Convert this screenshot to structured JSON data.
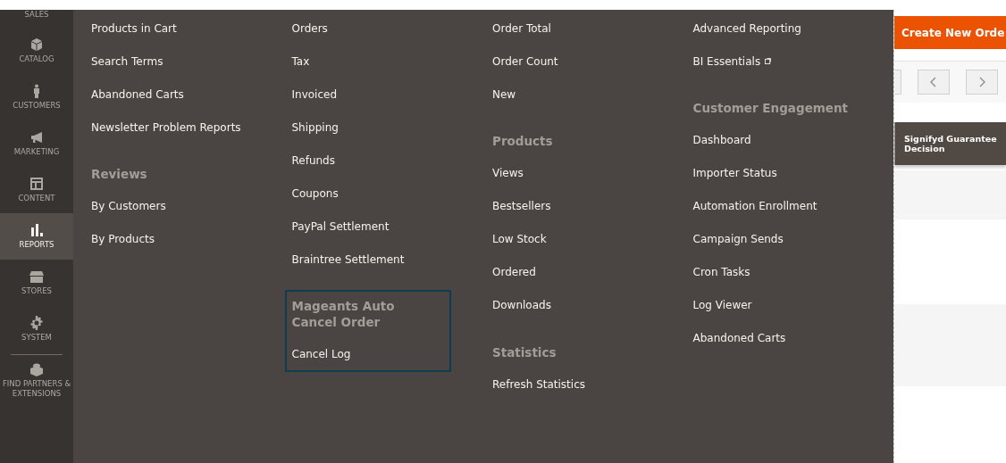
{
  "sidebar": {
    "items": [
      {
        "label": "SALES",
        "selected": false
      },
      {
        "label": "CATALOG",
        "selected": false
      },
      {
        "label": "CUSTOMERS",
        "selected": false
      },
      {
        "label": "MARKETING",
        "selected": false
      },
      {
        "label": "CONTENT",
        "selected": false
      },
      {
        "label": "REPORTS",
        "selected": true
      },
      {
        "label": "STORES",
        "selected": false
      },
      {
        "label": "SYSTEM",
        "selected": false
      },
      {
        "label": "FIND PARTNERS & EXTENSIONS",
        "selected": false,
        "divider_before": true
      }
    ]
  },
  "menu": {
    "columns": [
      {
        "groups": [
          {
            "items": [
              {
                "label": "Products in Cart"
              },
              {
                "label": "Search Terms"
              },
              {
                "label": "Abandoned Carts"
              },
              {
                "label": "Newsletter Problem Reports"
              }
            ]
          },
          {
            "title": "Reviews",
            "items": [
              {
                "label": "By Customers"
              },
              {
                "label": "By Products"
              }
            ]
          }
        ]
      },
      {
        "groups": [
          {
            "items": [
              {
                "label": "Orders"
              },
              {
                "label": "Tax"
              },
              {
                "label": "Invoiced"
              },
              {
                "label": "Shipping"
              },
              {
                "label": "Refunds"
              },
              {
                "label": "Coupons"
              },
              {
                "label": "PayPal Settlement"
              },
              {
                "label": "Braintree Settlement"
              }
            ]
          },
          {
            "title": "Mageants Auto Cancel Order",
            "focused": true,
            "items": [
              {
                "label": "Cancel Log"
              }
            ]
          }
        ]
      },
      {
        "groups": [
          {
            "items": [
              {
                "label": "Order Total"
              },
              {
                "label": "Order Count"
              },
              {
                "label": "New"
              }
            ]
          },
          {
            "title": "Products",
            "items": [
              {
                "label": "Views"
              },
              {
                "label": "Bestsellers"
              },
              {
                "label": "Low Stock"
              },
              {
                "label": "Ordered"
              },
              {
                "label": "Downloads"
              }
            ]
          },
          {
            "title": "Statistics",
            "items": [
              {
                "label": "Refresh Statistics"
              }
            ]
          }
        ]
      },
      {
        "groups": [
          {
            "items": [
              {
                "label": "Advanced Reporting"
              },
              {
                "label": "BI Essentials",
                "external": true
              }
            ]
          },
          {
            "title": "Customer Engagement",
            "items": [
              {
                "label": "Dashboard"
              },
              {
                "label": "Importer Status"
              },
              {
                "label": "Automation Enrollment"
              },
              {
                "label": "Campaign Sends"
              },
              {
                "label": "Cron Tasks"
              },
              {
                "label": "Log Viewer"
              },
              {
                "label": "Abandoned Carts"
              }
            ]
          }
        ]
      }
    ]
  },
  "page": {
    "button": "Create New Orde",
    "table_header": "Signifyd Guarantee Decision"
  }
}
